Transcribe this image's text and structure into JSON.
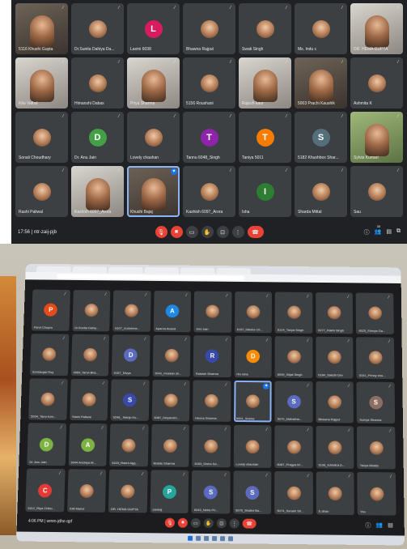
{
  "top": {
    "time": "17:56",
    "meeting_code": "ntr-zaij-pjb",
    "people_count": "35",
    "tiles": [
      {
        "name": "5116 Khushi Gupta",
        "kind": "video",
        "style": "dark"
      },
      {
        "name": "Dr.Sunita Dahiya Da...",
        "kind": "photo"
      },
      {
        "name": "Laxmi 6038",
        "kind": "letter",
        "letter": "L",
        "color": "#d81b60"
      },
      {
        "name": "Bhawna Rajput",
        "kind": "photo"
      },
      {
        "name": "Swati Singh",
        "kind": "photo"
      },
      {
        "name": "Ms. Indu c",
        "kind": "photo"
      },
      {
        "name": "DR. HEMA GUPTA",
        "kind": "video",
        "style": "light"
      },
      {
        "name": "Kitu Vathsl",
        "kind": "video",
        "style": "light"
      },
      {
        "name": "Himanshi Dabas",
        "kind": "photo"
      },
      {
        "name": "Priya Sharma",
        "kind": "video",
        "style": "light"
      },
      {
        "name": "5156 Roushani",
        "kind": "photo"
      },
      {
        "name": "Rajesh kaur",
        "kind": "video",
        "style": "light"
      },
      {
        "name": "5003 Prachi Kaushik",
        "kind": "video",
        "style": "dark"
      },
      {
        "name": "Ashmita K",
        "kind": "photo"
      },
      {
        "name": "Sonali Choudhary",
        "kind": "photo"
      },
      {
        "name": "Dr. Anu Jain",
        "kind": "letter",
        "letter": "D",
        "color": "#43a047"
      },
      {
        "name": "Lovely chauhan",
        "kind": "photo"
      },
      {
        "name": "Tannu 6048_Singh",
        "kind": "letter",
        "letter": "T",
        "color": "#8e24aa"
      },
      {
        "name": "Taniya 5011",
        "kind": "letter",
        "letter": "T",
        "color": "#f57c00"
      },
      {
        "name": "5182 Khushbox Shar...",
        "kind": "letter",
        "letter": "S",
        "color": "#546e7a"
      },
      {
        "name": "Sylvia Kumari",
        "kind": "video",
        "style": "green"
      },
      {
        "name": "Rashi Paliwal",
        "kind": "photo"
      },
      {
        "name": "Kashish 6097_Arora",
        "kind": "video",
        "style": "light"
      },
      {
        "name": "Khushi Bajaj",
        "kind": "video",
        "style": "dark",
        "active": true
      },
      {
        "name": "Kashish 6097_Arora",
        "kind": "photo"
      },
      {
        "name": "Isha",
        "kind": "letter",
        "letter": "I",
        "color": "#2e7d32"
      },
      {
        "name": "Sharda Mittal",
        "kind": "photo"
      },
      {
        "name": "Sau",
        "kind": "photo"
      }
    ]
  },
  "bottom": {
    "time": "4:06 PM",
    "meeting_code": "wmm-jdhe-qpf",
    "tiles": [
      {
        "name": "Parul Chopra",
        "kind": "letter",
        "letter": "P",
        "color": "#e64a19"
      },
      {
        "name": "Dr.Sunita Dahiy...",
        "kind": "photo"
      },
      {
        "name": "6107_Kurishma...",
        "kind": "photo"
      },
      {
        "name": "Aparna Anand",
        "kind": "letter",
        "letter": "A",
        "color": "#1e88e5"
      },
      {
        "name": "Kirti Jain",
        "kind": "photo"
      },
      {
        "name": "6157_Diksha Ch...",
        "kind": "photo"
      },
      {
        "name": "6124_Tanya Singh",
        "kind": "photo"
      },
      {
        "name": "5277_Rakhi Singh",
        "kind": "photo"
      },
      {
        "name": "6025_Shreya Ga...",
        "kind": "photo"
      },
      {
        "name": "5244Anjali Roy",
        "kind": "photo"
      },
      {
        "name": "6069_Tanvi Bha...",
        "kind": "photo"
      },
      {
        "name": "6157_Divya",
        "kind": "letter",
        "letter": "D",
        "color": "#5c6bc0"
      },
      {
        "name": "5041_muskan sh...",
        "kind": "photo"
      },
      {
        "name": "Rakesh Sharma",
        "kind": "letter",
        "letter": "R",
        "color": "#3949ab"
      },
      {
        "name": "ritu rana",
        "kind": "letter",
        "letter": "D",
        "color": "#fb8c00"
      },
      {
        "name": "6099_Srijal Singh",
        "kind": "photo"
      },
      {
        "name": "6184_Sakshi Dev",
        "kind": "photo"
      },
      {
        "name": "5161_Princy sha...",
        "kind": "photo"
      },
      {
        "name": "5034_Tanu kum...",
        "kind": "photo"
      },
      {
        "name": "Rashi Paliwal",
        "kind": "photo"
      },
      {
        "name": "5248_ Manju Ku...",
        "kind": "letter",
        "letter": "S",
        "color": "#3949ab"
      },
      {
        "name": "6087_Divyanshi...",
        "kind": "photo"
      },
      {
        "name": "Heena Sharma",
        "kind": "photo"
      },
      {
        "name": "5091_Sneha",
        "kind": "photo",
        "active": true
      },
      {
        "name": "5070_Mahakha...",
        "kind": "letter",
        "letter": "S",
        "color": "#5c6bc0"
      },
      {
        "name": "Bhawna Rajput",
        "kind": "photo"
      },
      {
        "name": "Sumya Sharma",
        "kind": "letter",
        "letter": "S",
        "color": "#8d6e63"
      },
      {
        "name": "Dr. Anu Jain",
        "kind": "letter",
        "letter": "D",
        "color": "#7cb342"
      },
      {
        "name": "6044 Anshiya M...",
        "kind": "letter",
        "letter": "A",
        "color": "#7cb342"
      },
      {
        "name": "6103_Rakhi Agg...",
        "kind": "photo"
      },
      {
        "name": "Mobile Sharma",
        "kind": "photo"
      },
      {
        "name": "5183_Disha Sa...",
        "kind": "photo"
      },
      {
        "name": "Lovely chauhan",
        "kind": "photo"
      },
      {
        "name": "6087_Pragya kh...",
        "kind": "photo"
      },
      {
        "name": "5196_KANIKA D...",
        "kind": "photo"
      },
      {
        "name": "Tanya Bhatia",
        "kind": "photo"
      },
      {
        "name": "5112_Riya Chibu...",
        "kind": "letter",
        "letter": "C",
        "color": "#e53935"
      },
      {
        "name": "Kriti Manvi",
        "kind": "photo"
      },
      {
        "name": "DR. HEMA GUPTA",
        "kind": "photo"
      },
      {
        "name": "pankaj",
        "kind": "letter",
        "letter": "P",
        "color": "#26a69a"
      },
      {
        "name": "5243_Neha Pri...",
        "kind": "letter",
        "letter": "S",
        "color": "#5c6bc0"
      },
      {
        "name": "5076_Shalini Ba...",
        "kind": "letter",
        "letter": "S",
        "color": "#5c6bc0"
      },
      {
        "name": "5074_Sonam Sh...",
        "kind": "photo"
      },
      {
        "name": "E.dhan",
        "kind": "photo"
      },
      {
        "name": "You",
        "kind": "photo"
      }
    ]
  },
  "colors": {
    "meet_bg": "#202124",
    "tile_bg": "#3c4043",
    "hangup_red": "#ea4335",
    "active_outline": "#8ab4f8"
  }
}
